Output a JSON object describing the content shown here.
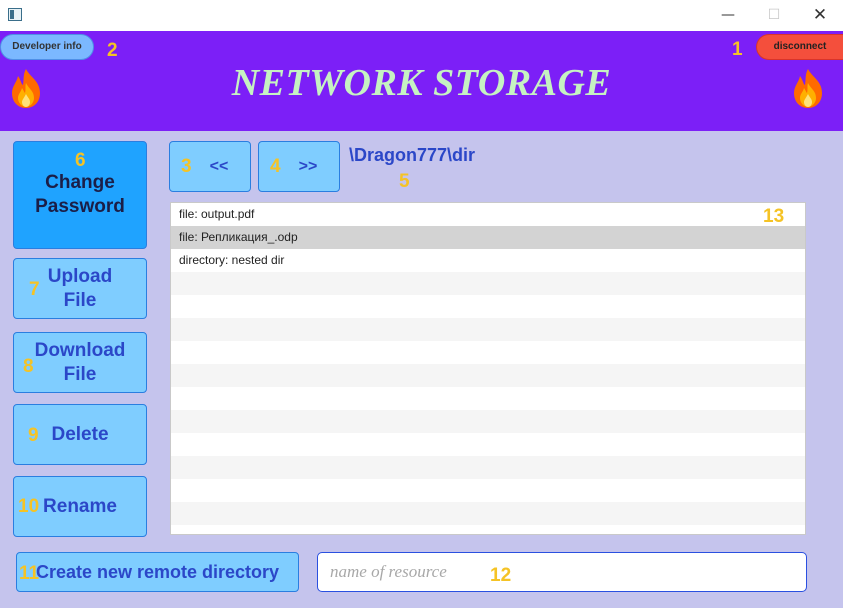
{
  "window": {
    "minimize_glyph": "—",
    "maximize_glyph": "☐",
    "close_glyph": "✕"
  },
  "header": {
    "title": "NETWORK STORAGE",
    "developer_info_label": "Developer info",
    "disconnect_label": "disconnect",
    "colors": {
      "background": "#7c1ff7",
      "title": "#c6f2c2",
      "disconnect": "#f44f3c",
      "developer_info": "#7bb8ff"
    }
  },
  "annotations": {
    "disconnect": "1",
    "developer_info": "2",
    "back": "3",
    "forward": "4",
    "path": "5",
    "change_password": "6",
    "upload": "7",
    "download": "8",
    "delete": "9",
    "rename": "10",
    "create_dir": "11",
    "resource_name": "12",
    "file_list": "13"
  },
  "sidebar": {
    "change_password": [
      "Change",
      "Password"
    ],
    "upload": [
      "Upload",
      "File"
    ],
    "download": [
      "Download",
      "File"
    ],
    "delete": "Delete",
    "rename": "Rename"
  },
  "nav": {
    "back_label": "<<",
    "forward_label": ">>",
    "current_path": "\\Dragon777\\dir"
  },
  "file_list": {
    "items": [
      "file: output.pdf",
      "file: Репликация_.odp",
      "directory: nested dir"
    ],
    "selected_index": 1
  },
  "bottom": {
    "create_dir_label": "Create new remote directory",
    "resource_placeholder": "name of resource",
    "resource_value": ""
  },
  "icons": [
    "app-icon",
    "flame-icon"
  ],
  "accent": {
    "button_fill": "#7fcdff",
    "button_text": "#2b47c8",
    "badge": "#f5c325"
  }
}
